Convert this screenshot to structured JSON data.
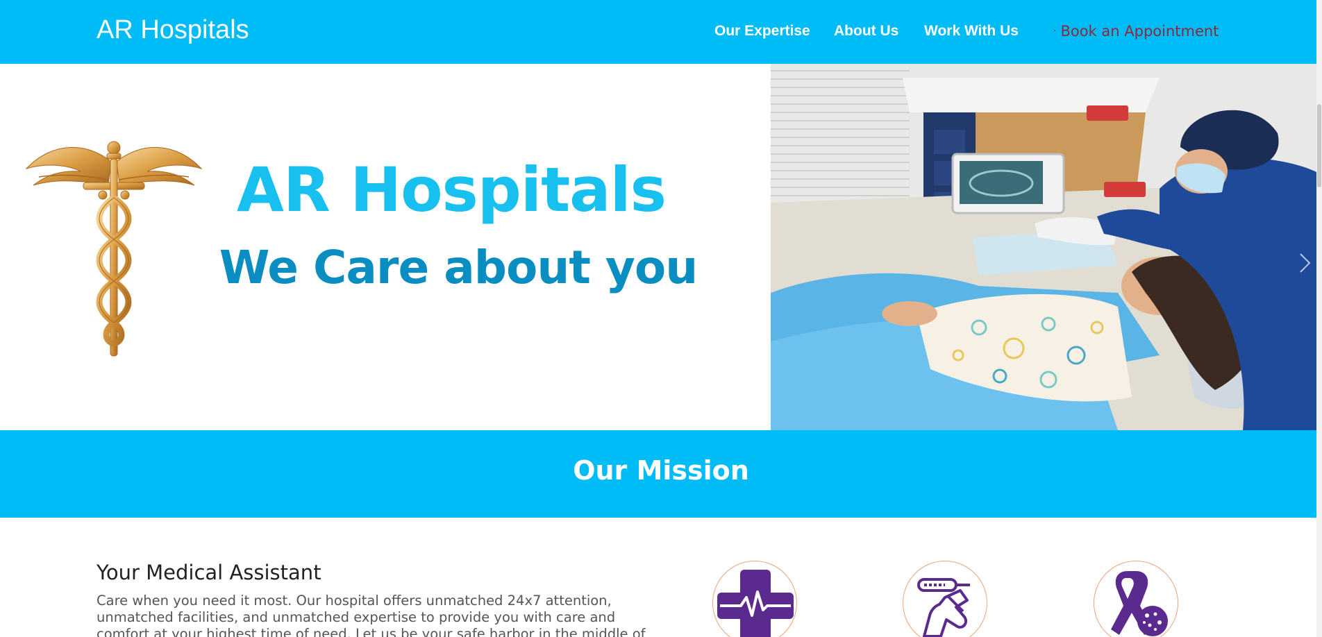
{
  "navbar": {
    "brand": "AR Hospitals",
    "links": [
      {
        "label": "Our Expertise"
      },
      {
        "label": "About Us"
      },
      {
        "label": "Work With Us"
      }
    ],
    "cta_label": "Book an Appointment",
    "cta_color": "#8b2a3c",
    "background": "#00bcf6"
  },
  "hero": {
    "title": "AR Hospitals",
    "tagline": "We Care about you",
    "title_color": "#17c0ef",
    "tagline_color": "#0a8ec2",
    "logo_icon": "caduceus-icon",
    "photo_icon": "dentist-patient-photo"
  },
  "mission": {
    "title": "Our Mission"
  },
  "content": {
    "heading": "Your Medical Assistant",
    "body": "Care when you need it most. Our hospital offers unmatched 24x7 attention, unmatched facilities, and unmatched expertise to provide you with care and comfort at your highest time of need. Let us be your safe harbor in the middle of the storm, offering",
    "features": [
      {
        "icon": "medical-cross-heartbeat-icon"
      },
      {
        "icon": "thermometer-hand-icon"
      },
      {
        "icon": "awareness-ribbon-icon"
      }
    ],
    "accent_purple": "#5b2a8e",
    "circle_border": "#f0a27a"
  }
}
